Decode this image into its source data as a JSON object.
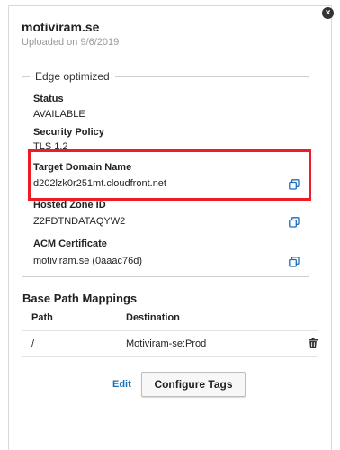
{
  "card": {
    "title": "motiviram.se",
    "subtitle": "Uploaded on 9/6/2019",
    "close_icon": "close-icon"
  },
  "edge": {
    "legend": "Edge optimized",
    "status_label": "Status",
    "status_value": "AVAILABLE",
    "security_label": "Security Policy",
    "security_value": "TLS 1.2",
    "target_label": "Target Domain Name",
    "target_value": "d202lzk0r251mt.cloudfront.net",
    "zone_label": "Hosted Zone ID",
    "zone_value": "Z2FDTNDATAQYW2",
    "acm_label": "ACM Certificate",
    "acm_value": "motiviram.se (0aaac76d)",
    "copy_icon": "copy-icon",
    "highlight_color": "#ee1c25"
  },
  "mappings": {
    "title": "Base Path Mappings",
    "col_path": "Path",
    "col_destination": "Destination",
    "rows": [
      {
        "path": "/",
        "destination": "Motiviram-se:Prod"
      }
    ],
    "delete_icon": "trash-icon"
  },
  "actions": {
    "edit_label": "Edit",
    "configure_tags_label": "Configure Tags",
    "link_color": "#1a6fb5"
  }
}
